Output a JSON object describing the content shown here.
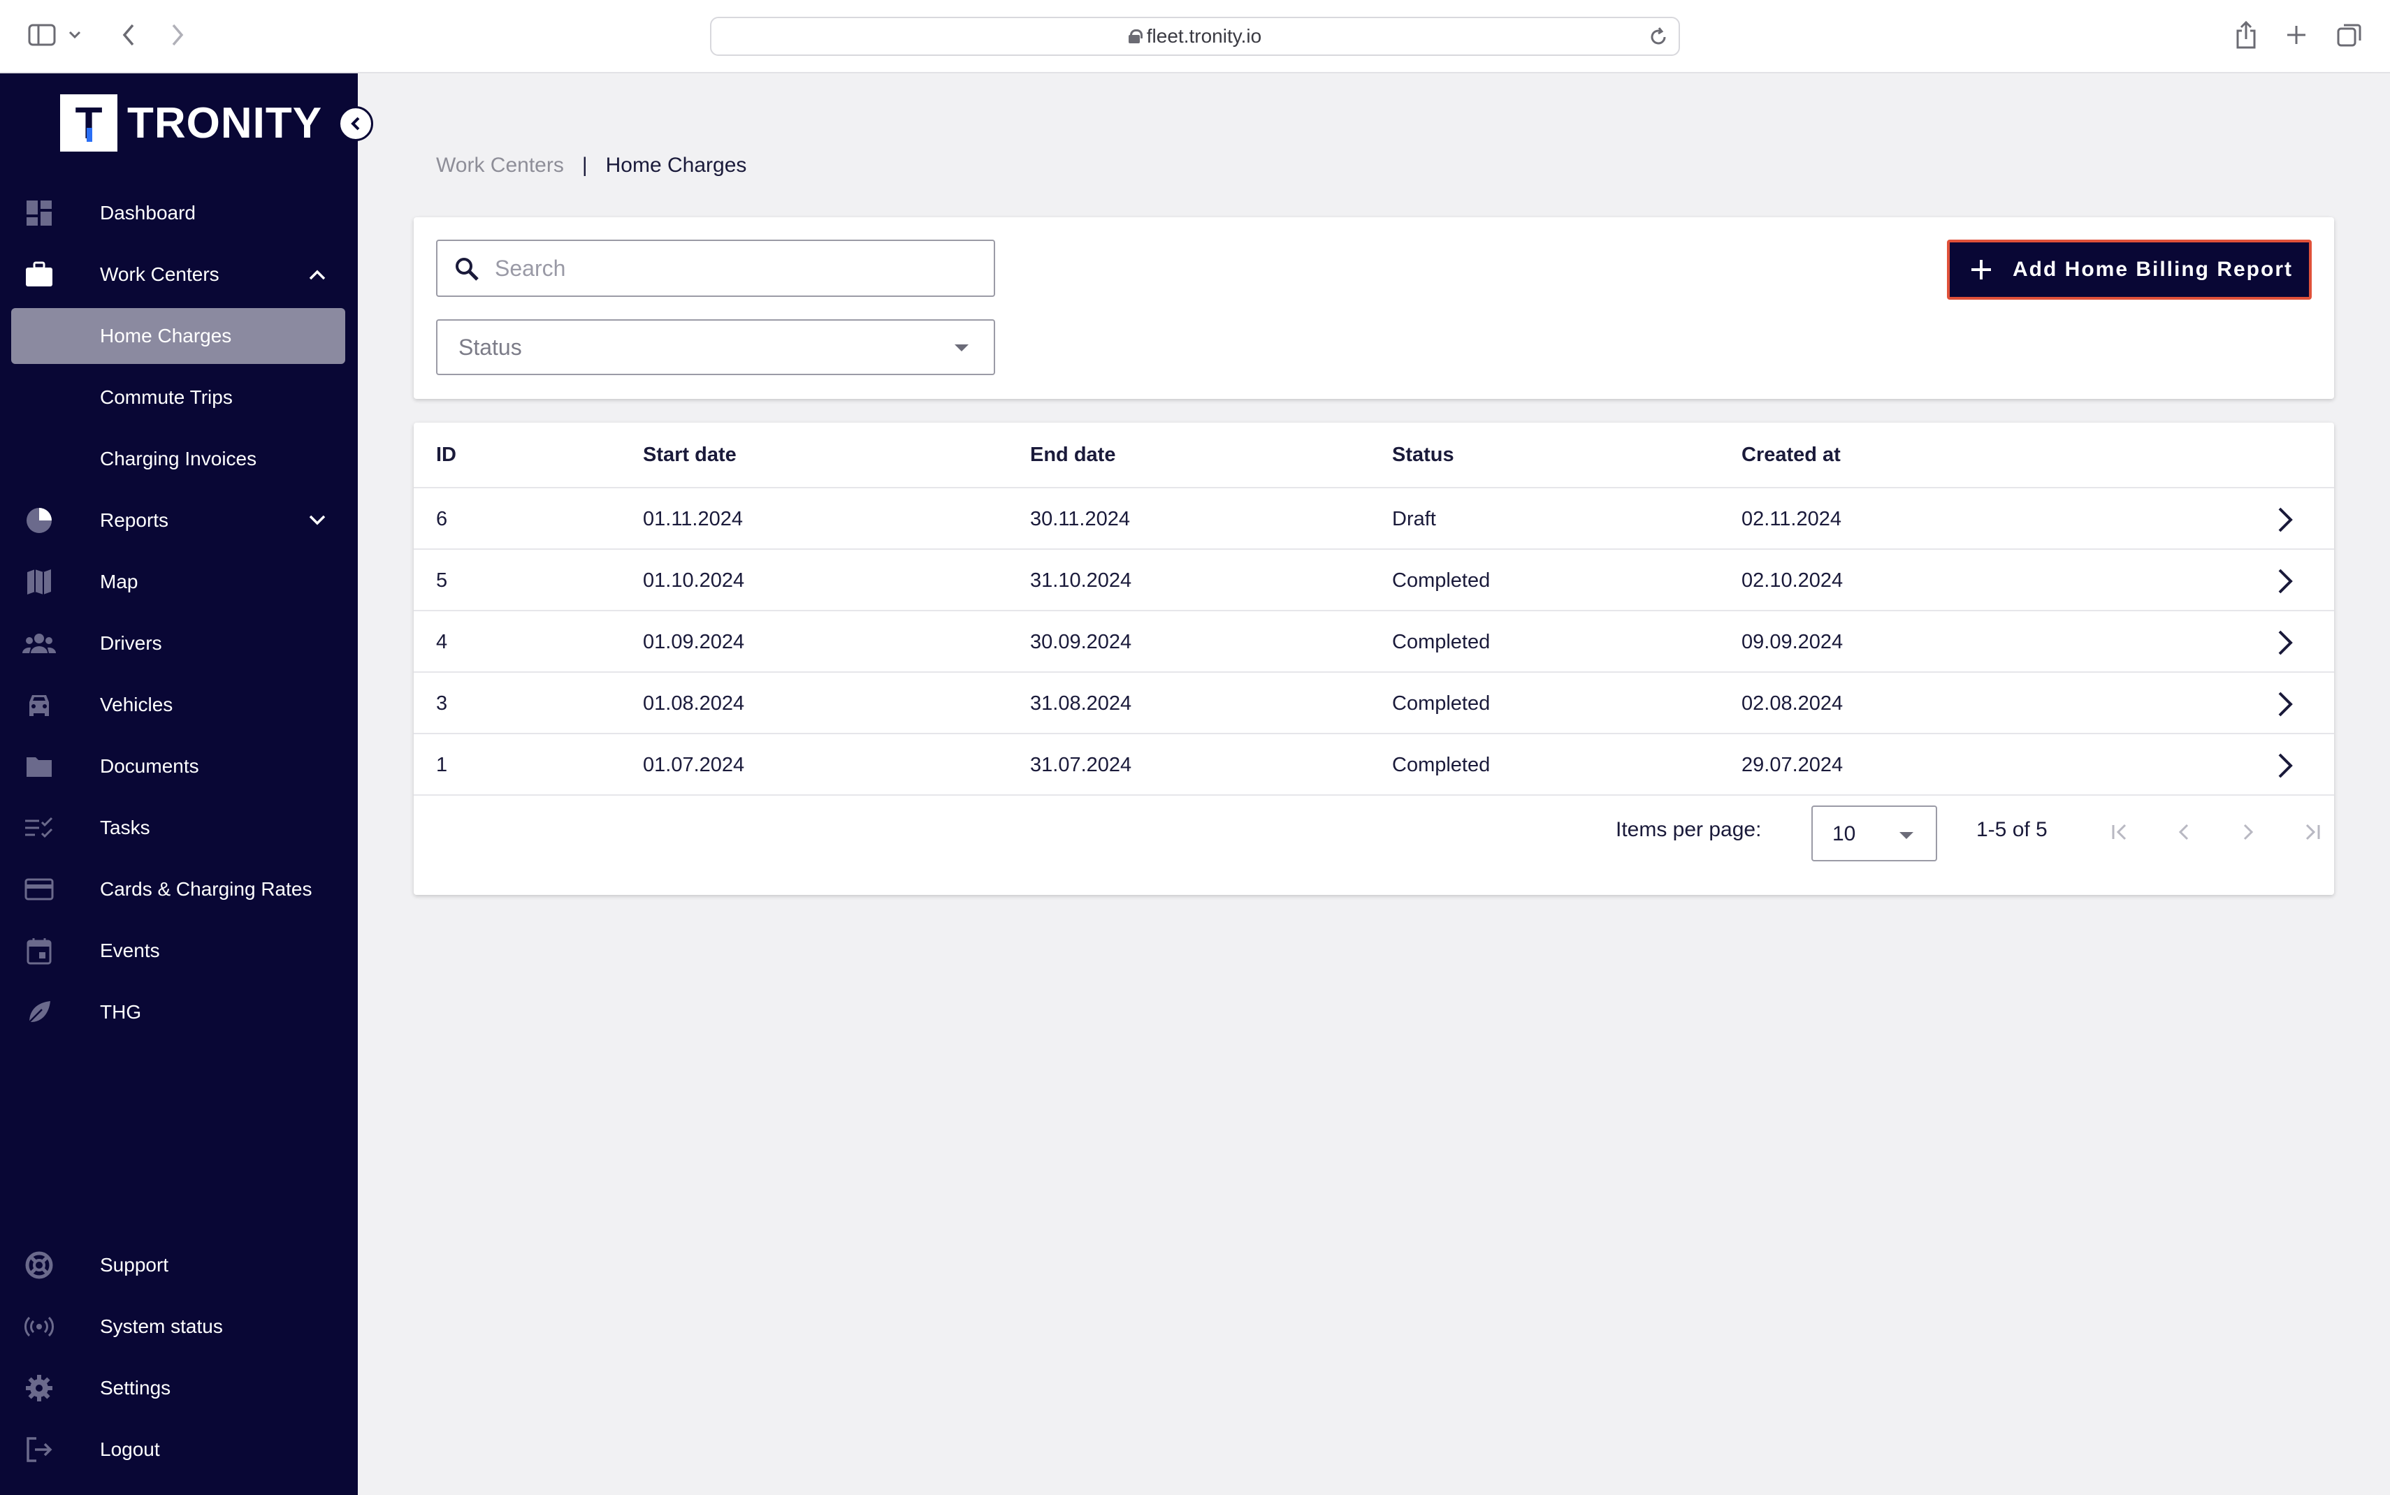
{
  "browser": {
    "url": "fleet.tronity.io"
  },
  "brand": {
    "logo_letter": "T",
    "name": "TRONITY",
    "sidebar_bg": "#090735",
    "accent_border": "#e0513a"
  },
  "sidebar": {
    "items": [
      {
        "label": "Dashboard",
        "icon": "dashboard-icon"
      },
      {
        "label": "Work Centers",
        "icon": "briefcase-icon",
        "expanded": true
      },
      {
        "label": "Home Charges",
        "active": true
      },
      {
        "label": "Commute Trips"
      },
      {
        "label": "Charging Invoices"
      },
      {
        "label": "Reports",
        "icon": "pie-chart-icon",
        "expanded": false
      },
      {
        "label": "Map",
        "icon": "map-icon"
      },
      {
        "label": "Drivers",
        "icon": "people-icon"
      },
      {
        "label": "Vehicles",
        "icon": "car-icon"
      },
      {
        "label": "Documents",
        "icon": "folder-icon"
      },
      {
        "label": "Tasks",
        "icon": "checklist-icon"
      },
      {
        "label": "Cards & Charging Rates",
        "icon": "card-icon"
      },
      {
        "label": "Events",
        "icon": "calendar-icon"
      },
      {
        "label": "THG",
        "icon": "leaf-icon"
      }
    ],
    "bottom": [
      {
        "label": "Support",
        "icon": "lifebuoy-icon"
      },
      {
        "label": "System status",
        "icon": "broadcast-icon"
      },
      {
        "label": "Settings",
        "icon": "gear-icon"
      },
      {
        "label": "Logout",
        "icon": "logout-icon"
      }
    ]
  },
  "breadcrumb": {
    "parent": "Work Centers",
    "separator": "|",
    "current": "Home Charges"
  },
  "filters": {
    "search_placeholder": "Search",
    "status_placeholder": "Status",
    "add_button": "Add Home Billing Report"
  },
  "table": {
    "columns": [
      "ID",
      "Start date",
      "End date",
      "Status",
      "Created at"
    ],
    "rows": [
      {
        "id": "6",
        "start": "01.11.2024",
        "end": "30.11.2024",
        "status": "Draft",
        "created": "02.11.2024"
      },
      {
        "id": "5",
        "start": "01.10.2024",
        "end": "31.10.2024",
        "status": "Completed",
        "created": "02.10.2024"
      },
      {
        "id": "4",
        "start": "01.09.2024",
        "end": "30.09.2024",
        "status": "Completed",
        "created": "09.09.2024"
      },
      {
        "id": "3",
        "start": "01.08.2024",
        "end": "31.08.2024",
        "status": "Completed",
        "created": "02.08.2024"
      },
      {
        "id": "1",
        "start": "01.07.2024",
        "end": "31.07.2024",
        "status": "Completed",
        "created": "29.07.2024"
      }
    ]
  },
  "pagination": {
    "items_per_page_label": "Items per page:",
    "items_per_page": "10",
    "range": "1-5 of 5"
  }
}
